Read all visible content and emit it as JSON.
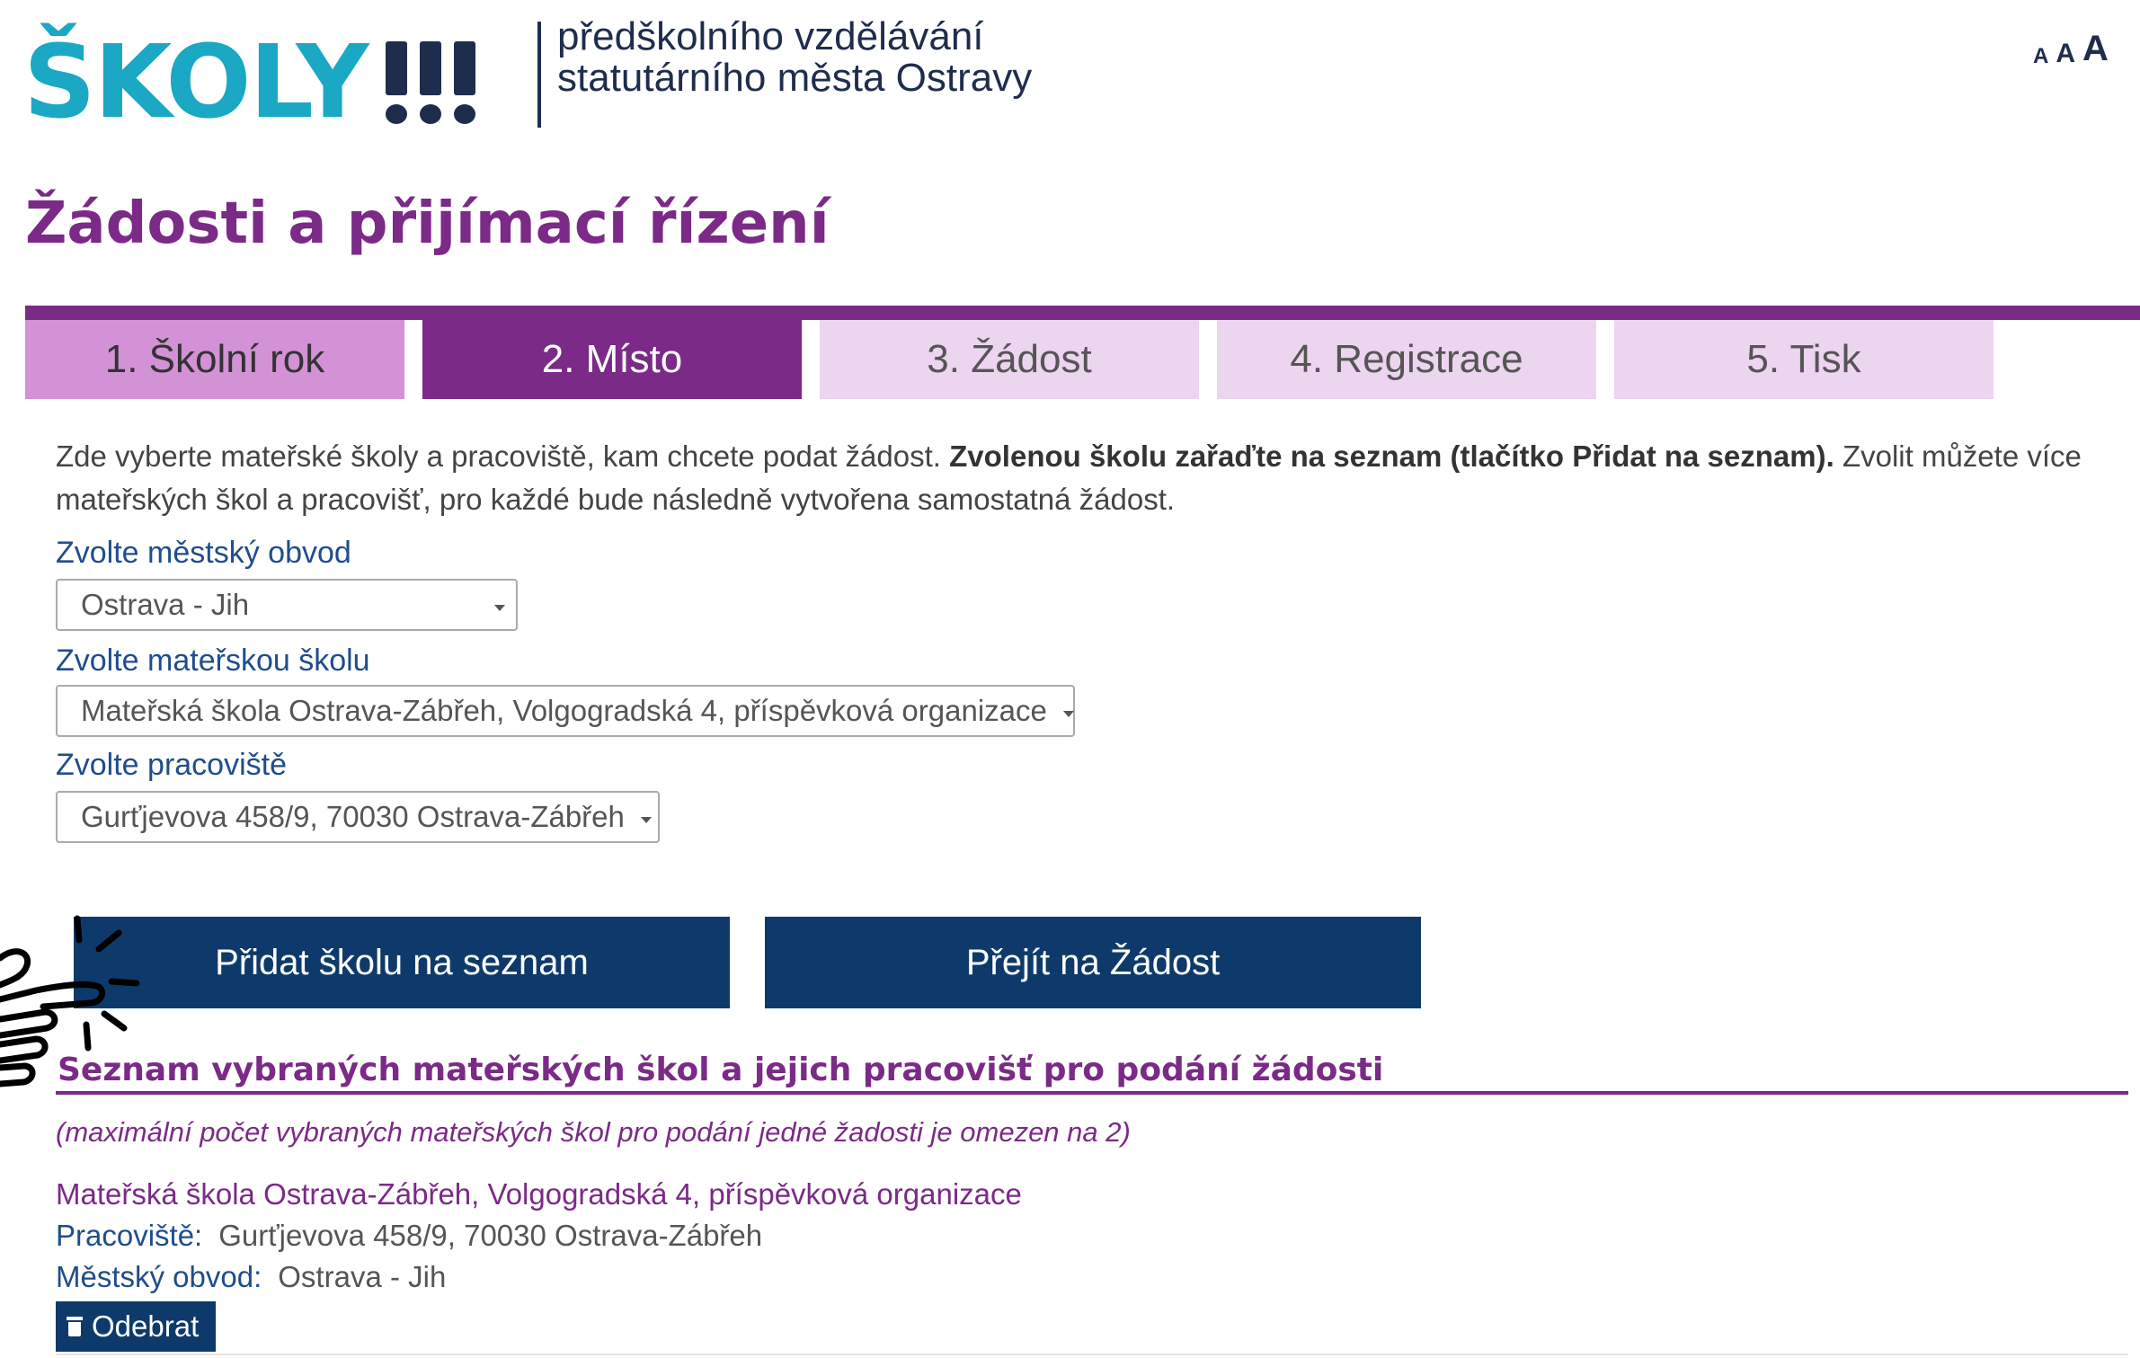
{
  "header": {
    "logo_text": "ŠKOLY",
    "subtitle_line1": "předškolního vzdělávání",
    "subtitle_line2": "statutárního města Ostravy",
    "font_size_small": "A",
    "font_size_medium": "A",
    "font_size_large": "A"
  },
  "page": {
    "title": "Žádosti a přijímací řízení"
  },
  "steps": [
    {
      "label": "1. Školní rok",
      "state": "done"
    },
    {
      "label": "2. Místo",
      "state": "active"
    },
    {
      "label": "3. Žádost",
      "state": "todo"
    },
    {
      "label": "4. Registrace",
      "state": "todo"
    },
    {
      "label": "5. Tisk",
      "state": "todo"
    }
  ],
  "intro": {
    "part1": "Zde vyberte mateřské školy a pracoviště, kam chcete podat žádost. ",
    "bold": "Zvolenou školu zařaďte na seznam (tlačítko Přidat na seznam).",
    "part2": " Zvolit můžete více mateřských škol a pracovišť, pro každé bude následně vytvořena samostatná žádost."
  },
  "form": {
    "district_label": "Zvolte městský obvod",
    "district_value": "Ostrava - Jih",
    "school_label": "Zvolte mateřskou školu",
    "school_value": "Mateřská škola Ostrava-Zábřeh, Volgogradská 4, příspěvková organizace",
    "workplace_label": "Zvolte pracoviště",
    "workplace_value": "Gurťjevova 458/9, 70030 Ostrava-Zábřeh"
  },
  "actions": {
    "add_label": "Přidat školu na seznam",
    "proceed_label": "Přejít na Žádost"
  },
  "selected": {
    "heading": "Seznam vybraných mateřských škol a jejich pracovišť pro podání žádosti",
    "note": "(maximální počet vybraných mateřských škol pro podání jedné žadosti je omezen na 2)",
    "items": [
      {
        "school": "Mateřská škola Ostrava-Zábřeh, Volgogradská 4, příspěvková organizace",
        "workplace_key": "Pracoviště:",
        "workplace": "Gurťjevova 458/9, 70030 Ostrava-Zábřeh",
        "district_key": "Městský obvod:",
        "district": "Ostrava - Jih",
        "remove_label": "Odebrat"
      }
    ]
  },
  "colors": {
    "brand_cyan": "#1aa8c4",
    "brand_navy": "#1f2d4d",
    "accent_purple": "#7b2a87",
    "button_navy": "#0e3a6b",
    "step_done": "#d391d6",
    "step_todo": "#ecd5ee"
  },
  "icons": {
    "logo_mark": "triple-exclamation-icon",
    "pointer": "pointing-hand-icon",
    "remove": "trash-icon",
    "select_caret": "caret-down-icon"
  }
}
